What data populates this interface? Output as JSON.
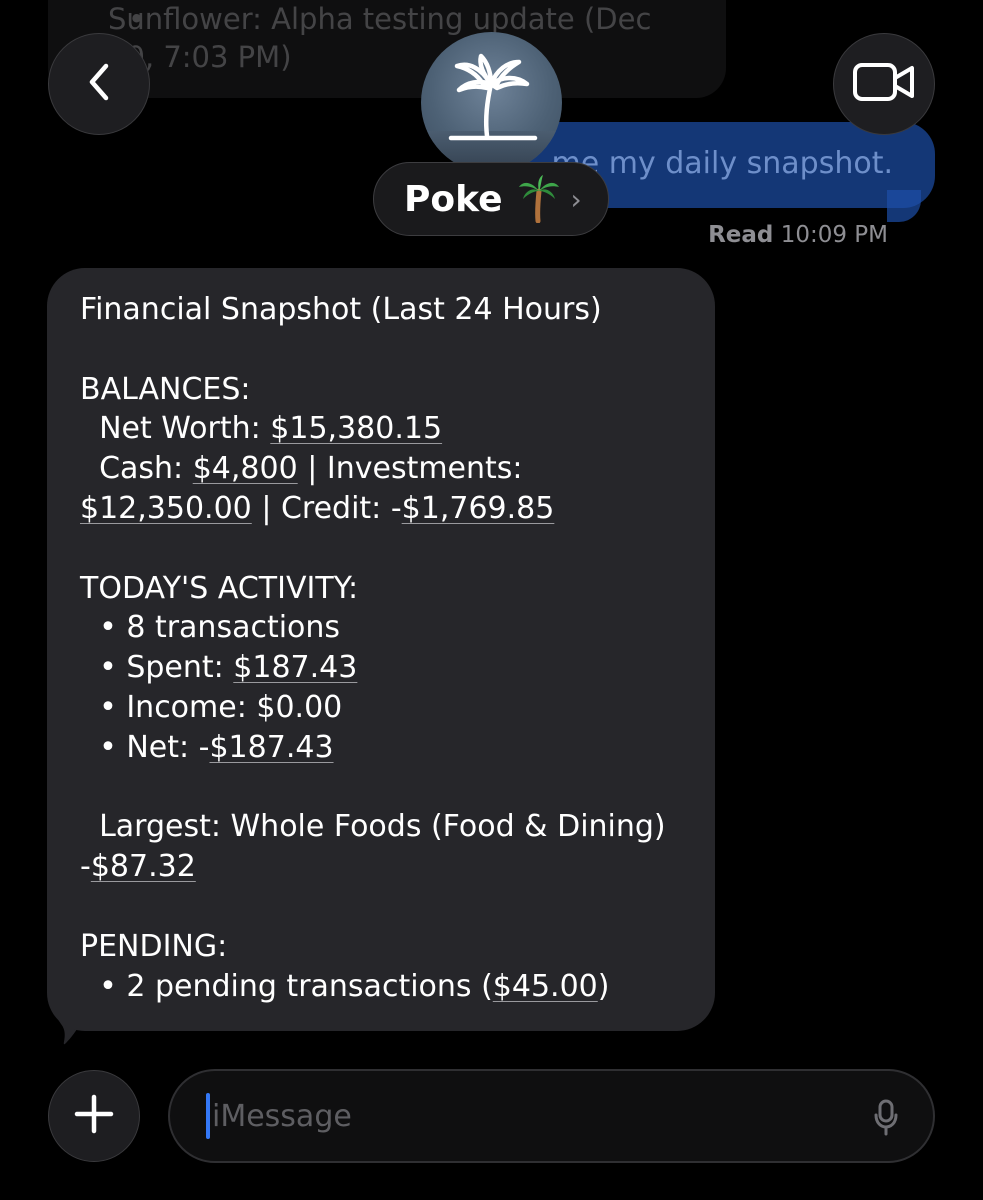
{
  "thread": {
    "previous_message_fragment": "Sunflower: Alpha testing update (Dec 30, 7:03 PM)",
    "outgoing_message_visible": "me my daily snapshot.",
    "read_receipt_label": "Read",
    "read_receipt_time": "10:09 PM"
  },
  "header": {
    "contact_name": "Poke",
    "avatar_icon": "palm-tree-icon",
    "name_emoji_icon": "palm-tree-emoji",
    "back_icon": "chevron-left-icon",
    "video_icon": "video-camera-icon",
    "chevron": "›"
  },
  "message": {
    "title": "Financial Snapshot (Last 24 Hours)",
    "balances_header": "BALANCES:",
    "net_worth_label": "Net Worth: ",
    "net_worth": "$15,380.15",
    "cash_label": "Cash: ",
    "cash": "$4,800",
    "investments_label": " | Investments:",
    "investments": "$12,350.00",
    "credit_label": " | Credit: -",
    "credit": "$1,769.85",
    "activity_header": "TODAY'S ACTIVITY:",
    "bullet": "•",
    "transactions": "8 transactions",
    "spent_label": "Spent: ",
    "spent": "$187.43",
    "income": "Income: $0.00",
    "net_label": "Net: -",
    "net": "$187.43",
    "largest_label": "Largest: Whole Foods (Food & Dining)",
    "largest_prefix": "-",
    "largest_amount": "$87.32",
    "pending_header": "PENDING:",
    "pending_label": "2 pending transactions (",
    "pending_amount": "$45.00",
    "pending_close": ")"
  },
  "compose": {
    "plus_icon": "plus-icon",
    "placeholder": "iMessage",
    "mic_icon": "microphone-icon"
  },
  "colors": {
    "background": "#000000",
    "incoming_bubble": "#26262a",
    "outgoing_bubble": "#1d4fa8",
    "cursor": "#3478f6"
  }
}
